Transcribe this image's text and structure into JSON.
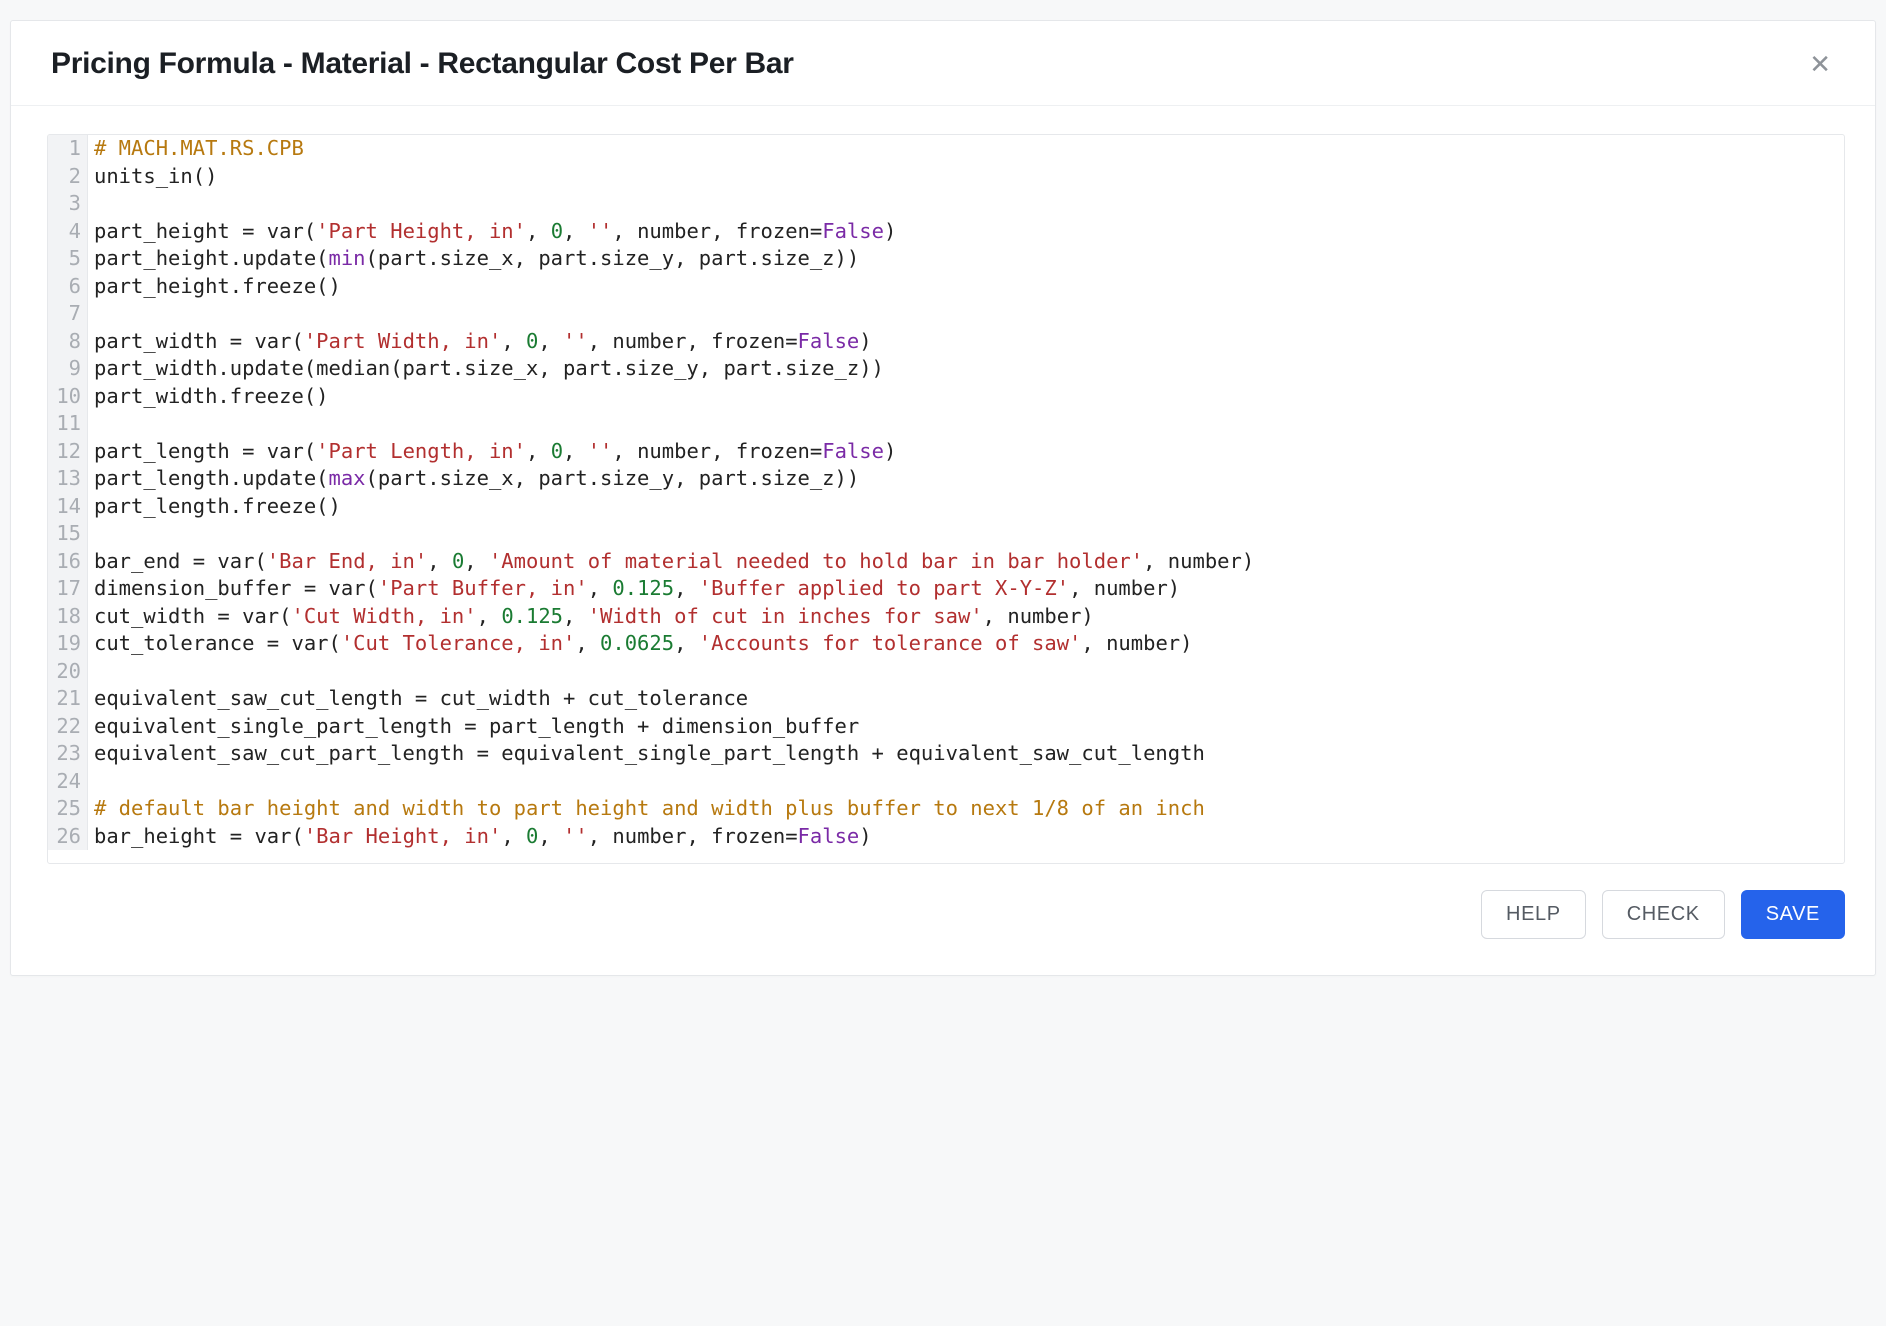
{
  "modal": {
    "title": "Pricing Formula - Material - Rectangular Cost Per Bar",
    "close_glyph": "✕"
  },
  "buttons": {
    "help": "HELP",
    "check": "CHECK",
    "save": "SAVE"
  },
  "code_lines": [
    [
      {
        "t": "comment",
        "v": "# MACH.MAT.RS.CPB"
      }
    ],
    [
      {
        "t": "plain",
        "v": "units_in()"
      }
    ],
    [],
    [
      {
        "t": "plain",
        "v": "part_height = var("
      },
      {
        "t": "string",
        "v": "'Part Height, in'"
      },
      {
        "t": "plain",
        "v": ", "
      },
      {
        "t": "number",
        "v": "0"
      },
      {
        "t": "plain",
        "v": ", "
      },
      {
        "t": "string",
        "v": "''"
      },
      {
        "t": "plain",
        "v": ", number, frozen="
      },
      {
        "t": "builtin",
        "v": "False"
      },
      {
        "t": "plain",
        "v": ")"
      }
    ],
    [
      {
        "t": "plain",
        "v": "part_height.update("
      },
      {
        "t": "builtin",
        "v": "min"
      },
      {
        "t": "plain",
        "v": "(part.size_x, part.size_y, part.size_z))"
      }
    ],
    [
      {
        "t": "plain",
        "v": "part_height.freeze()"
      }
    ],
    [],
    [
      {
        "t": "plain",
        "v": "part_width = var("
      },
      {
        "t": "string",
        "v": "'Part Width, in'"
      },
      {
        "t": "plain",
        "v": ", "
      },
      {
        "t": "number",
        "v": "0"
      },
      {
        "t": "plain",
        "v": ", "
      },
      {
        "t": "string",
        "v": "''"
      },
      {
        "t": "plain",
        "v": ", number, frozen="
      },
      {
        "t": "builtin",
        "v": "False"
      },
      {
        "t": "plain",
        "v": ")"
      }
    ],
    [
      {
        "t": "plain",
        "v": "part_width.update(median(part.size_x, part.size_y, part.size_z))"
      }
    ],
    [
      {
        "t": "plain",
        "v": "part_width.freeze()"
      }
    ],
    [],
    [
      {
        "t": "plain",
        "v": "part_length = var("
      },
      {
        "t": "string",
        "v": "'Part Length, in'"
      },
      {
        "t": "plain",
        "v": ", "
      },
      {
        "t": "number",
        "v": "0"
      },
      {
        "t": "plain",
        "v": ", "
      },
      {
        "t": "string",
        "v": "''"
      },
      {
        "t": "plain",
        "v": ", number, frozen="
      },
      {
        "t": "builtin",
        "v": "False"
      },
      {
        "t": "plain",
        "v": ")"
      }
    ],
    [
      {
        "t": "plain",
        "v": "part_length.update("
      },
      {
        "t": "builtin",
        "v": "max"
      },
      {
        "t": "plain",
        "v": "(part.size_x, part.size_y, part.size_z))"
      }
    ],
    [
      {
        "t": "plain",
        "v": "part_length.freeze()"
      }
    ],
    [],
    [
      {
        "t": "plain",
        "v": "bar_end = var("
      },
      {
        "t": "string",
        "v": "'Bar End, in'"
      },
      {
        "t": "plain",
        "v": ", "
      },
      {
        "t": "number",
        "v": "0"
      },
      {
        "t": "plain",
        "v": ", "
      },
      {
        "t": "string",
        "v": "'Amount of material needed to hold bar in bar holder'"
      },
      {
        "t": "plain",
        "v": ", number)"
      }
    ],
    [
      {
        "t": "plain",
        "v": "dimension_buffer = var("
      },
      {
        "t": "string",
        "v": "'Part Buffer, in'"
      },
      {
        "t": "plain",
        "v": ", "
      },
      {
        "t": "number",
        "v": "0.125"
      },
      {
        "t": "plain",
        "v": ", "
      },
      {
        "t": "string",
        "v": "'Buffer applied to part X-Y-Z'"
      },
      {
        "t": "plain",
        "v": ", number)"
      }
    ],
    [
      {
        "t": "plain",
        "v": "cut_width = var("
      },
      {
        "t": "string",
        "v": "'Cut Width, in'"
      },
      {
        "t": "plain",
        "v": ", "
      },
      {
        "t": "number",
        "v": "0.125"
      },
      {
        "t": "plain",
        "v": ", "
      },
      {
        "t": "string",
        "v": "'Width of cut in inches for saw'"
      },
      {
        "t": "plain",
        "v": ", number)"
      }
    ],
    [
      {
        "t": "plain",
        "v": "cut_tolerance = var("
      },
      {
        "t": "string",
        "v": "'Cut Tolerance, in'"
      },
      {
        "t": "plain",
        "v": ", "
      },
      {
        "t": "number",
        "v": "0.0625"
      },
      {
        "t": "plain",
        "v": ", "
      },
      {
        "t": "string",
        "v": "'Accounts for tolerance of saw'"
      },
      {
        "t": "plain",
        "v": ", number)"
      }
    ],
    [],
    [
      {
        "t": "plain",
        "v": "equivalent_saw_cut_length = cut_width + cut_tolerance"
      }
    ],
    [
      {
        "t": "plain",
        "v": "equivalent_single_part_length = part_length + dimension_buffer"
      }
    ],
    [
      {
        "t": "plain",
        "v": "equivalent_saw_cut_part_length = equivalent_single_part_length + equivalent_saw_cut_length"
      }
    ],
    [],
    [
      {
        "t": "comment",
        "v": "# default bar height and width to part height and width plus buffer to next 1/8 of an inch"
      }
    ],
    [
      {
        "t": "plain",
        "v": "bar_height = var("
      },
      {
        "t": "string",
        "v": "'Bar Height, in'"
      },
      {
        "t": "plain",
        "v": ", "
      },
      {
        "t": "number",
        "v": "0"
      },
      {
        "t": "plain",
        "v": ", "
      },
      {
        "t": "string",
        "v": "''"
      },
      {
        "t": "plain",
        "v": ", number, frozen="
      },
      {
        "t": "builtin",
        "v": "False"
      },
      {
        "t": "plain",
        "v": ")"
      }
    ]
  ]
}
